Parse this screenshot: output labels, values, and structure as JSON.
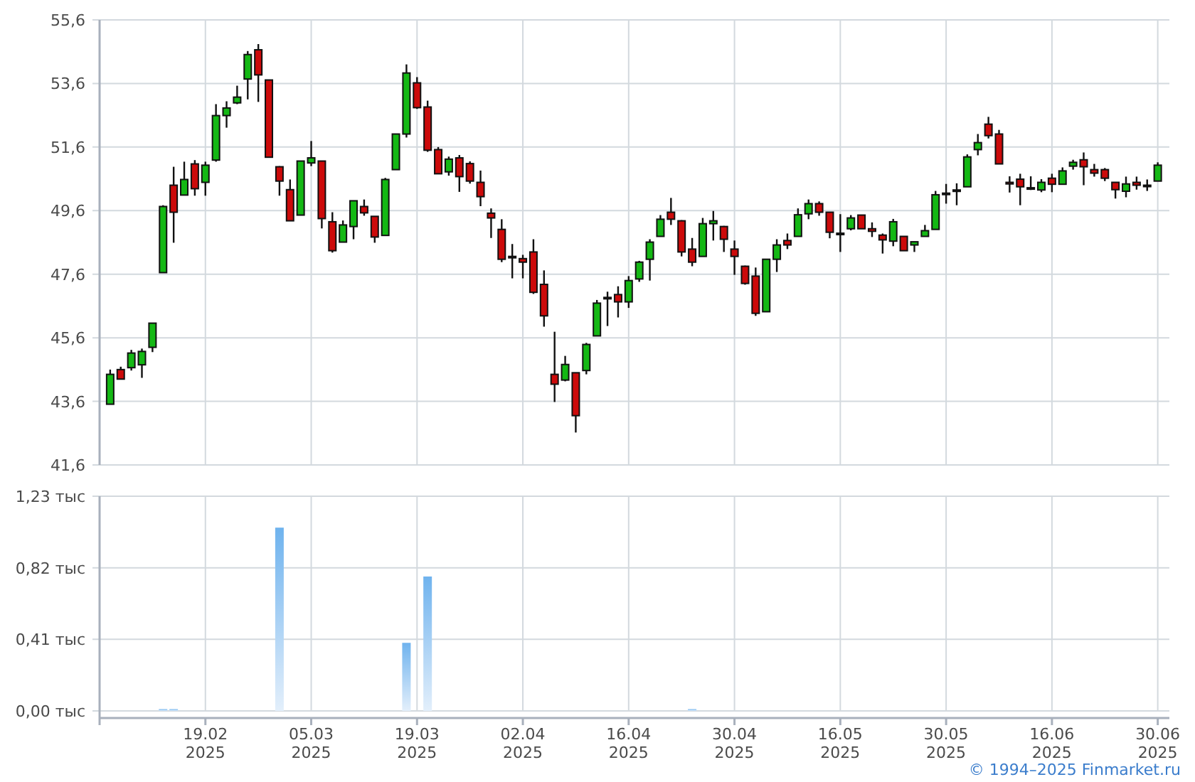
{
  "price_chart": {
    "chart_data": {
      "type": "candlestick",
      "grid": true,
      "ylim": [
        41.6,
        55.6
      ],
      "categories": [
        null,
        null,
        null,
        null,
        null,
        null,
        null,
        null,
        null,
        null,
        null,
        null,
        null,
        null,
        null,
        null,
        null,
        null,
        null,
        null,
        null,
        null,
        null,
        null,
        null,
        null,
        null,
        null,
        null,
        null,
        null,
        null,
        null,
        null,
        null,
        null,
        null,
        null,
        null,
        null,
        null,
        null,
        null,
        null,
        null,
        null,
        null,
        null,
        null,
        null,
        null,
        null,
        null,
        null,
        null,
        null,
        null,
        null,
        null,
        null,
        null,
        null,
        null,
        null,
        null,
        null,
        null,
        null,
        null,
        null,
        null,
        null,
        null,
        null,
        null,
        null,
        null,
        null,
        null,
        null,
        null,
        null,
        null,
        null,
        null,
        null,
        null,
        null,
        null,
        null,
        null,
        null,
        null,
        null,
        null,
        null,
        null,
        null,
        null,
        null
      ],
      "yticks": [
        {
          "value": 41.6,
          "label": "41,6"
        },
        {
          "value": 43.6,
          "label": "43,6"
        },
        {
          "value": 45.6,
          "label": "45,6"
        },
        {
          "value": 47.6,
          "label": "47,6"
        },
        {
          "value": 49.6,
          "label": "49,6"
        },
        {
          "value": 51.6,
          "label": "51,6"
        },
        {
          "value": 53.6,
          "label": "53,6"
        },
        {
          "value": 55.6,
          "label": "55,6"
        }
      ],
      "ohlc": [
        [
          43.51,
          44.6,
          43.51,
          44.45
        ],
        [
          44.6,
          44.69,
          44.3,
          44.3
        ],
        [
          44.66,
          45.22,
          44.57,
          45.12
        ],
        [
          44.75,
          45.26,
          44.34,
          45.17
        ],
        [
          45.3,
          46.06,
          45.15,
          46.06
        ],
        [
          47.65,
          49.77,
          47.65,
          49.73
        ],
        [
          50.4,
          50.98,
          48.59,
          49.55
        ],
        [
          50.09,
          51.14,
          50.09,
          50.58
        ],
        [
          51.07,
          51.19,
          50.07,
          50.29
        ],
        [
          50.49,
          51.14,
          50.07,
          51.03
        ],
        [
          51.19,
          52.95,
          51.14,
          52.59
        ],
        [
          52.59,
          53.04,
          52.21,
          52.83
        ],
        [
          52.99,
          53.53,
          52.95,
          53.17
        ],
        [
          53.74,
          54.62,
          53.1,
          54.51
        ],
        [
          54.66,
          54.84,
          53.02,
          53.87
        ],
        [
          53.71,
          53.71,
          51.28,
          51.28
        ],
        [
          50.98,
          51.0,
          50.07,
          50.53
        ],
        [
          50.26,
          50.58,
          49.28,
          49.28
        ],
        [
          49.46,
          51.16,
          49.46,
          51.16
        ],
        [
          51.1,
          51.79,
          51.0,
          51.26
        ],
        [
          51.16,
          51.16,
          49.04,
          49.35
        ],
        [
          49.25,
          49.55,
          48.28,
          48.34
        ],
        [
          48.61,
          49.29,
          48.61,
          49.15
        ],
        [
          49.1,
          49.91,
          48.7,
          49.91
        ],
        [
          49.73,
          49.95,
          49.44,
          49.53
        ],
        [
          49.42,
          49.42,
          48.59,
          48.77
        ],
        [
          48.82,
          50.63,
          48.82,
          50.58
        ],
        [
          50.89,
          52.01,
          50.89,
          52.01
        ],
        [
          52.01,
          54.2,
          51.9,
          53.93
        ],
        [
          53.62,
          53.8,
          52.8,
          52.84
        ],
        [
          52.86,
          53.06,
          51.45,
          51.5
        ],
        [
          51.52,
          51.6,
          50.76,
          50.76
        ],
        [
          50.82,
          51.3,
          50.7,
          51.22
        ],
        [
          51.26,
          51.35,
          50.19,
          50.67
        ],
        [
          51.08,
          51.15,
          50.45,
          50.53
        ],
        [
          50.49,
          50.86,
          49.74,
          50.04
        ],
        [
          49.52,
          49.67,
          48.74,
          49.37
        ],
        [
          49.01,
          49.33,
          47.98,
          48.07
        ],
        [
          48.16,
          48.55,
          47.47,
          48.16
        ],
        [
          48.09,
          48.21,
          47.47,
          47.98
        ],
        [
          48.3,
          48.7,
          46.98,
          47.03
        ],
        [
          47.28,
          47.72,
          45.95,
          46.29
        ],
        [
          44.45,
          45.79,
          43.58,
          44.14
        ],
        [
          44.27,
          45.03,
          44.23,
          44.76
        ],
        [
          44.5,
          44.5,
          42.62,
          43.15
        ],
        [
          44.57,
          45.44,
          44.45,
          45.39
        ],
        [
          45.66,
          46.79,
          45.66,
          46.69
        ],
        [
          46.87,
          47.05,
          45.97,
          46.87
        ],
        [
          46.96,
          47.22,
          46.24,
          46.73
        ],
        [
          46.73,
          47.54,
          46.54,
          47.4
        ],
        [
          47.45,
          48.02,
          47.36,
          47.98
        ],
        [
          48.07,
          48.7,
          47.4,
          48.61
        ],
        [
          48.79,
          49.46,
          48.79,
          49.33
        ],
        [
          49.55,
          50.0,
          49.15,
          49.33
        ],
        [
          49.28,
          49.3,
          48.16,
          48.3
        ],
        [
          48.39,
          48.74,
          47.85,
          47.98
        ],
        [
          48.16,
          49.37,
          48.16,
          49.19
        ],
        [
          49.19,
          49.59,
          48.66,
          49.28
        ],
        [
          49.1,
          49.12,
          48.3,
          48.7
        ],
        [
          48.39,
          48.66,
          47.58,
          48.16
        ],
        [
          47.85,
          47.87,
          47.27,
          47.31
        ],
        [
          47.54,
          47.81,
          46.29,
          46.37
        ],
        [
          46.42,
          48.07,
          46.42,
          48.07
        ],
        [
          48.07,
          48.7,
          47.67,
          48.52
        ],
        [
          48.66,
          48.88,
          48.39,
          48.52
        ],
        [
          48.79,
          49.67,
          48.79,
          49.47
        ],
        [
          49.5,
          49.95,
          49.33,
          49.82
        ],
        [
          49.82,
          49.89,
          49.44,
          49.55
        ],
        [
          49.55,
          49.55,
          48.73,
          48.92
        ],
        [
          48.89,
          49.49,
          48.3,
          48.89
        ],
        [
          49.03,
          49.46,
          48.98,
          49.37
        ],
        [
          49.46,
          49.46,
          49.03,
          49.03
        ],
        [
          49.03,
          49.23,
          48.77,
          48.95
        ],
        [
          48.83,
          48.88,
          48.25,
          48.68
        ],
        [
          48.64,
          49.34,
          48.48,
          49.25
        ],
        [
          48.79,
          48.79,
          48.34,
          48.34
        ],
        [
          48.52,
          48.62,
          48.3,
          48.62
        ],
        [
          48.79,
          49.15,
          48.79,
          48.97
        ],
        [
          49.01,
          50.22,
          49.01,
          50.1
        ],
        [
          50.13,
          50.44,
          49.82,
          50.15
        ],
        [
          50.22,
          50.46,
          49.77,
          50.25
        ],
        [
          50.35,
          51.37,
          50.35,
          51.29
        ],
        [
          51.52,
          52.01,
          51.34,
          51.74
        ],
        [
          52.32,
          52.55,
          51.87,
          51.96
        ],
        [
          52.01,
          52.14,
          51.07,
          51.07
        ],
        [
          50.49,
          50.68,
          50.17,
          50.44
        ],
        [
          50.59,
          50.76,
          49.77,
          50.35
        ],
        [
          50.32,
          50.68,
          50.25,
          50.3
        ],
        [
          50.25,
          50.59,
          50.18,
          50.49
        ],
        [
          50.62,
          50.76,
          50.18,
          50.43
        ],
        [
          50.43,
          50.96,
          50.43,
          50.85
        ],
        [
          51.0,
          51.2,
          50.89,
          51.12
        ],
        [
          51.2,
          51.43,
          50.4,
          50.98
        ],
        [
          50.89,
          51.07,
          50.67,
          50.78
        ],
        [
          50.89,
          50.94,
          50.53,
          50.62
        ],
        [
          50.49,
          50.49,
          49.98,
          50.26
        ],
        [
          50.21,
          50.67,
          50.02,
          50.44
        ],
        [
          50.49,
          50.67,
          50.26,
          50.4
        ],
        [
          50.4,
          50.58,
          50.22,
          50.4
        ],
        [
          50.53,
          51.12,
          50.53,
          51.03
        ]
      ]
    }
  },
  "volume_chart": {
    "chart_data": {
      "type": "bar",
      "grid": true,
      "ylim": [
        0,
        1.23
      ],
      "categories": [
        null,
        null,
        null,
        null,
        null,
        null,
        null,
        null,
        null,
        "19.02\n2025",
        null,
        null,
        null,
        null,
        null,
        null,
        null,
        null,
        null,
        "05.03\n2025",
        null,
        null,
        null,
        null,
        null,
        null,
        null,
        null,
        null,
        "19.03\n2025",
        null,
        null,
        null,
        null,
        null,
        null,
        null,
        null,
        null,
        "02.04\n2025",
        null,
        null,
        null,
        null,
        null,
        null,
        null,
        null,
        null,
        "16.04\n2025",
        null,
        null,
        null,
        null,
        null,
        null,
        null,
        null,
        null,
        "30.04\n2025",
        null,
        null,
        null,
        null,
        null,
        null,
        null,
        null,
        null,
        "16.05\n2025",
        null,
        null,
        null,
        null,
        null,
        null,
        null,
        null,
        null,
        "30.05\n2025",
        null,
        null,
        null,
        null,
        null,
        null,
        null,
        null,
        null,
        "16.06\n2025",
        null,
        null,
        null,
        null,
        null,
        null,
        null,
        null,
        null,
        "30.06\n2025"
      ],
      "yticks": [
        {
          "value": 0,
          "label": "0,00 тыс"
        },
        {
          "value": 0.41,
          "label": "0,41 тыс"
        },
        {
          "value": 0.82,
          "label": "0,82 тыс"
        },
        {
          "value": 1.23,
          "label": "1,23 тыс"
        }
      ],
      "values": [
        0,
        0,
        0,
        0,
        0,
        0.01,
        0.01,
        0,
        0,
        0,
        0,
        0,
        0,
        0,
        0,
        0,
        1.05,
        0,
        0,
        0,
        0,
        0,
        0,
        0,
        0,
        0,
        0,
        0,
        0.39,
        0,
        0.77,
        0,
        0,
        0,
        0,
        0,
        0,
        0,
        0,
        0,
        0,
        0,
        0,
        0,
        0,
        0,
        0,
        0,
        0,
        0,
        0,
        0,
        0,
        0,
        0,
        0.01,
        0,
        0,
        0,
        0,
        0,
        0,
        0,
        0,
        0,
        0,
        0,
        0,
        0,
        0,
        0,
        0,
        0,
        0,
        0,
        0,
        0,
        0,
        0,
        0,
        0,
        0,
        0,
        0,
        0,
        0,
        0,
        0,
        0,
        0,
        0,
        0,
        0,
        0,
        0,
        0,
        0,
        0,
        0,
        0
      ]
    }
  },
  "footer": {
    "copyright": "© 1994–2025 Finmarket.ru"
  }
}
